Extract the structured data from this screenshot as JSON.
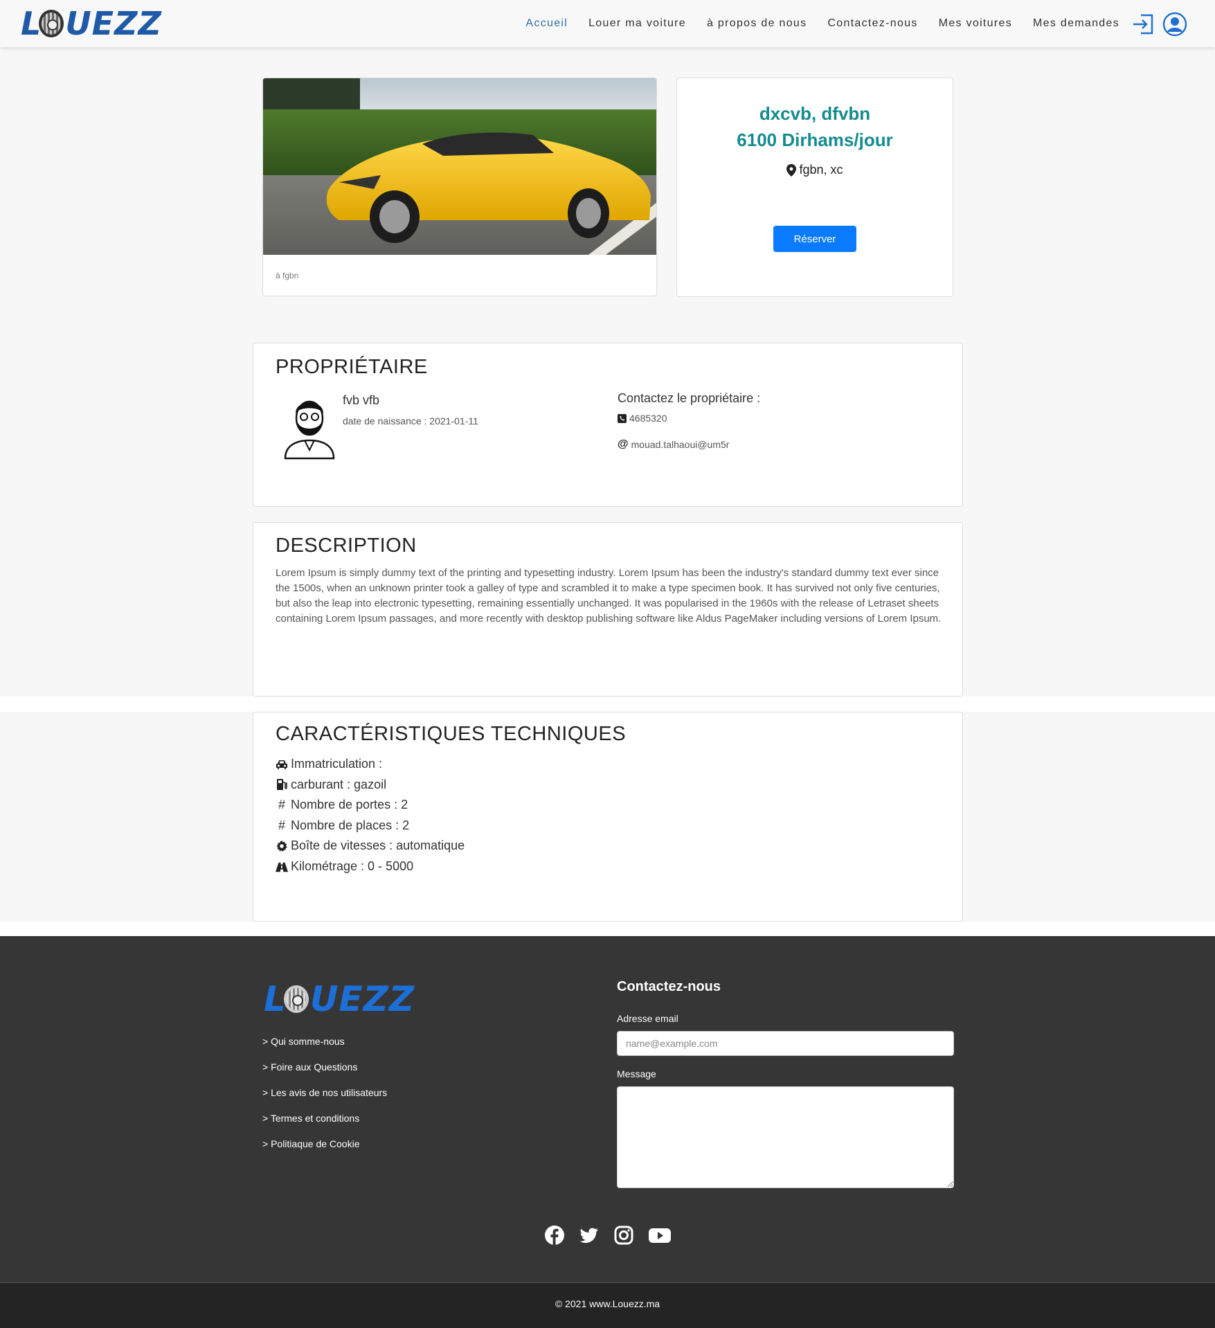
{
  "brand": {
    "logo_left": "L",
    "logo_right": "UEZZ",
    "accent_color": "#1f5aa8",
    "title_color": "#148b8f",
    "button_color": "#0a7bff"
  },
  "nav": {
    "items": [
      {
        "label": "Accueil",
        "active": true
      },
      {
        "label": "Louer ma voiture"
      },
      {
        "label": "à propos de nous"
      },
      {
        "label": "Contactez-nous"
      },
      {
        "label": "Mes voitures"
      },
      {
        "label": "Mes demandes"
      }
    ],
    "icons": [
      "login-icon",
      "user-circle-icon"
    ]
  },
  "car": {
    "caption": "à fgbn",
    "title": "dxcvb,   dfvbn",
    "price": "6100 Dirhams/jour",
    "location": "fgbn,   xc",
    "reserve_label": "Réserver"
  },
  "owner": {
    "section_title": "PROPRIÉTAIRE",
    "name": "fvb vfb",
    "dob": "date de naissance : 2021-01-11",
    "contact_heading": "Contactez le propriétaire :",
    "phone": "4685320",
    "email": "mouad.talhaoui@um5r"
  },
  "description": {
    "section_title": "DESCRIPTION",
    "text": "Lorem Ipsum is simply dummy text of the printing and typesetting industry. Lorem Ipsum has been the industry's standard dummy text ever since the 1500s, when an unknown printer took a galley of type and scrambled it to make a type specimen book. It has survived not only five centuries, but also the leap into electronic typesetting, remaining essentially unchanged. It was popularised in the 1960s with the release of Letraset sheets containing Lorem Ipsum passages, and more recently with desktop publishing software like Aldus PageMaker including versions of Lorem Ipsum."
  },
  "tech": {
    "section_title": "CARACTÉRISTIQUES TECHNIQUES",
    "items": [
      {
        "icon": "car-icon",
        "label": "Immatriculation  :"
      },
      {
        "icon": "fuel-pump-icon",
        "label": "carburant  : gazoil"
      },
      {
        "icon": "hash-icon",
        "label": "Nombre de portes  : 2"
      },
      {
        "icon": "hash-icon",
        "label": "Nombre de places  : 2"
      },
      {
        "icon": "gear-icon",
        "label": "Boîte de vitesses  : automatique"
      },
      {
        "icon": "road-icon",
        "label": "Kilométrage  : 0 - 5000"
      }
    ]
  },
  "footer": {
    "links": [
      "> Qui somme-nous",
      "> Foire aux Questions",
      "> Les avis de nos utilisateurs",
      "> Termes et conditions",
      "> Politiaque de Cookie"
    ],
    "contact_title": "Contactez-nous",
    "email_label": "Adresse email",
    "email_placeholder": "name@example.com",
    "message_label": "Message",
    "socials": [
      "facebook-icon",
      "twitter-icon",
      "instagram-icon",
      "youtube-icon"
    ],
    "copyright": "© 2021 www.Louezz.ma"
  }
}
